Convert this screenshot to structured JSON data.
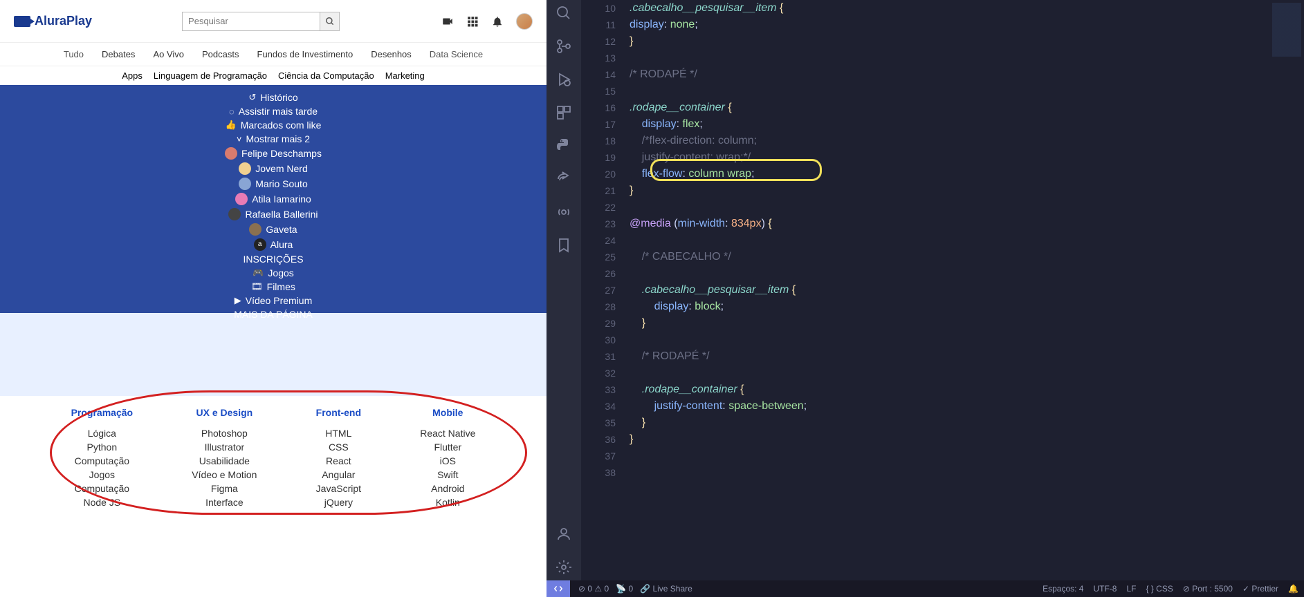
{
  "header": {
    "logo": "AluraPlay",
    "search_placeholder": "Pesquisar"
  },
  "chips_row1": [
    "Tudo",
    "Debates",
    "Ao Vivo",
    "Podcasts",
    "Fundos de Investimento",
    "Desenhos",
    "Data Science"
  ],
  "chips_row2": [
    "Apps",
    "Linguagem de Programação",
    "Ciência da Computação",
    "Marketing"
  ],
  "sidebar": {
    "historico": "Histórico",
    "assistir": "Assistir mais tarde",
    "marcados": "Marcados com like",
    "mostrar": "Mostrar mais 2",
    "channels": [
      "Felipe Deschamps",
      "Jovem Nerd",
      "Mario Souto",
      "Atila Iamarino",
      "Rafaella Ballerini",
      "Gaveta",
      "Alura"
    ],
    "inscricoes": "INSCRIÇÕES",
    "jogos": "Jogos",
    "filmes": "Filmes",
    "premium": "Vídeo Premium",
    "mais": "MAIS DA PÁGINA"
  },
  "footer": {
    "cols": [
      {
        "title": "Programação",
        "items": [
          "Lógica",
          "Python",
          "Computação",
          "Jogos",
          "Computação",
          "Node JS"
        ]
      },
      {
        "title": "UX e Design",
        "items": [
          "Photoshop",
          "Illustrator",
          "Usabilidade",
          "Vídeo e Motion",
          "Figma",
          "Interface"
        ]
      },
      {
        "title": "Front-end",
        "items": [
          "HTML",
          "CSS",
          "React",
          "Angular",
          "JavaScript",
          "jQuery"
        ]
      },
      {
        "title": "Mobile",
        "items": [
          "React Native",
          "Flutter",
          "iOS",
          "Swift",
          "Android",
          "Kotlin"
        ]
      }
    ]
  },
  "editor": {
    "lines": [
      {
        "n": 10,
        "html": "<span class='c-sel'>.cabecalho__pesquisar__item</span> <span class='c-bracket'>{</span>"
      },
      {
        "n": 11,
        "html": "<span class='c-prop'>display</span><span class='c-punc'>:</span> <span class='c-val'>none</span><span class='c-punc'>;</span>"
      },
      {
        "n": 12,
        "html": "<span class='c-bracket'>}</span>"
      },
      {
        "n": 13,
        "html": ""
      },
      {
        "n": 14,
        "html": "<span class='c-comment'>/* RODAPÉ */</span>"
      },
      {
        "n": 15,
        "html": ""
      },
      {
        "n": 16,
        "html": "<span class='c-sel'>.rodape__container</span> <span class='c-bracket'>{</span>"
      },
      {
        "n": 17,
        "html": "    <span class='c-prop'>display</span><span class='c-punc'>:</span> <span class='c-val'>flex</span><span class='c-punc'>;</span>"
      },
      {
        "n": 18,
        "html": "    <span class='c-comment'>/*flex-direction: column;</span>"
      },
      {
        "n": 19,
        "html": "    <span class='c-comment'>justify-content: wrap;*/</span>"
      },
      {
        "n": 20,
        "html": "    <span class='c-prop'>flex-flow</span><span class='c-punc'>:</span> <span class='c-val'>column wrap</span><span class='c-punc'>;</span>"
      },
      {
        "n": 21,
        "html": "<span class='c-bracket'>}</span>"
      },
      {
        "n": 22,
        "html": ""
      },
      {
        "n": 23,
        "html": "<span class='c-at'>@media</span> <span class='c-punc'>(</span><span class='c-prop'>min-width</span><span class='c-punc'>:</span> <span class='c-num'>834px</span><span class='c-punc'>)</span> <span class='c-bracket'>{</span>"
      },
      {
        "n": 24,
        "html": ""
      },
      {
        "n": 25,
        "html": "    <span class='c-comment'>/* CABECALHO */</span>"
      },
      {
        "n": 26,
        "html": ""
      },
      {
        "n": 27,
        "html": "    <span class='c-sel'>.cabecalho__pesquisar__item</span> <span class='c-bracket'>{</span>"
      },
      {
        "n": 28,
        "html": "        <span class='c-prop'>display</span><span class='c-punc'>:</span> <span class='c-val'>block</span><span class='c-punc'>;</span>"
      },
      {
        "n": 29,
        "html": "    <span class='c-bracket'>}</span>"
      },
      {
        "n": 30,
        "html": ""
      },
      {
        "n": 31,
        "html": "    <span class='c-comment'>/* RODAPÉ */</span>"
      },
      {
        "n": 32,
        "html": ""
      },
      {
        "n": 33,
        "html": "    <span class='c-sel'>.rodape__container</span> <span class='c-bracket'>{</span>"
      },
      {
        "n": 34,
        "html": "        <span class='c-prop'>justify-content</span><span class='c-punc'>:</span> <span class='c-val'>space-between</span><span class='c-punc'>;</span>"
      },
      {
        "n": 35,
        "html": "    <span class='c-bracket'>}</span>"
      },
      {
        "n": 36,
        "html": "<span class='c-bracket'>}</span>"
      },
      {
        "n": 37,
        "html": ""
      },
      {
        "n": 38,
        "html": ""
      }
    ]
  },
  "statusbar": {
    "errors": "0",
    "warnings": "0",
    "radio": "0",
    "liveshare": "Live Share",
    "spaces": "Espaços: 4",
    "encoding": "UTF-8",
    "lf": "LF",
    "lang": "CSS",
    "port": "Port : 5500",
    "prettier": "Prettier"
  }
}
